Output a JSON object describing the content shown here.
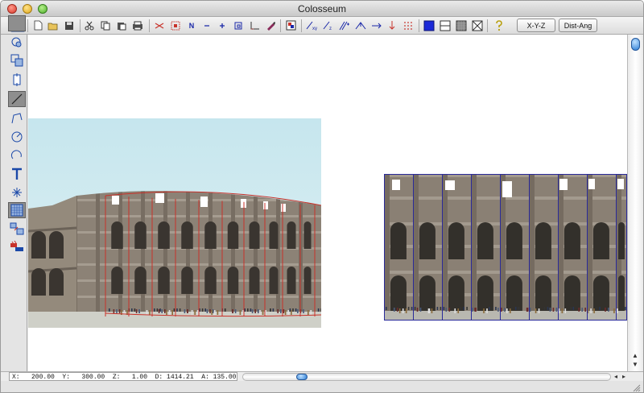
{
  "window": {
    "title": "Colosseum"
  },
  "toolbar": {
    "xyz_button": "X-Y-Z",
    "distang_button": "Dist-Ang",
    "n_glyph": "N"
  },
  "status": {
    "text": "X:   200.00  Y:   300.00  Z:   1.00  D: 1414.21  A: 135.00"
  },
  "colors": {
    "red_outline": "#c8322a",
    "blue_outline": "#2a2a9a",
    "accent": "#2f7fd6",
    "fill_blue": "#1a28d8"
  }
}
